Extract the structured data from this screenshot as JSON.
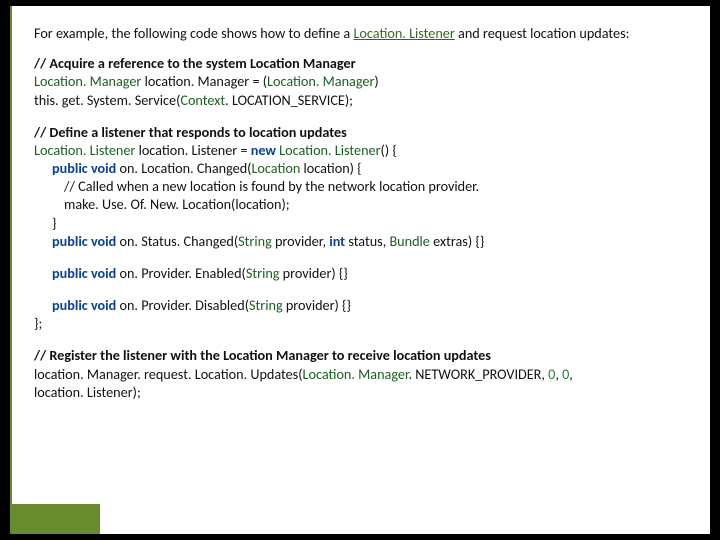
{
  "intro": {
    "pre": "For example, the following code shows how to define a ",
    "link": "Location. Listener",
    "post": " and request location updates:"
  },
  "block1": {
    "comment": "// Acquire a reference to the system Location Manager",
    "l2_type": "Location. Manager",
    "l2_rest": " location. Manager = (",
    "l2_cast": "Location. Manager",
    "l2_close": ")",
    "l3_pre": "this. get. System. Service",
    "l3_paren_open": "(",
    "l3_ctx": "Context",
    "l3_field": ". LOCATION_SERVICE",
    "l3_close": ");"
  },
  "block2": {
    "comment": "// Define a listener that responds to location updates",
    "decl_type": "Location. Listener",
    "decl_mid": " location. Listener = ",
    "decl_new": "new",
    "decl_ctor": " Location. Listener",
    "decl_end": "() {",
    "m1_pub": "public void",
    "m1_name": " on. Location. Changed(",
    "m1_arg_t": "Location",
    "m1_arg_n": " location) {",
    "m1_comment": "// Called when a new location is found by the network location provider.",
    "m1_body": "make. Use. Of. New. Location(location);",
    "m1_close": "}",
    "m2_pub": "public void",
    "m2_name": " on. Status. Changed(",
    "m2_a1t": "String",
    "m2_a1n": " provider, ",
    "m2_a2t": "int",
    "m2_a2n": " status, ",
    "m2_a3t": "Bundle",
    "m2_a3n": " extras) {}",
    "m3_pub": "public void",
    "m3_name": " on. Provider. Enabled(",
    "m3_a1t": "String",
    "m3_a1n": " provider) {}",
    "m4_pub": "public void",
    "m4_name": " on. Provider. Disabled(",
    "m4_a1t": "String",
    "m4_a1n": " provider) {}",
    "close": " };"
  },
  "block3": {
    "comment": "// Register the listener with the Location Manager to receive location updates",
    "l2_pre": "location. Manager. request. Location. Updates(",
    "l2_cls": "Location. Manager",
    "l2_field": ". NETWORK_PROVIDER",
    "l2_c1": ", ",
    "l2_n1": "0",
    "l2_c2": ", ",
    "l2_n2": "0",
    "l2_c3": ",",
    "l3": "location. Listener);"
  }
}
